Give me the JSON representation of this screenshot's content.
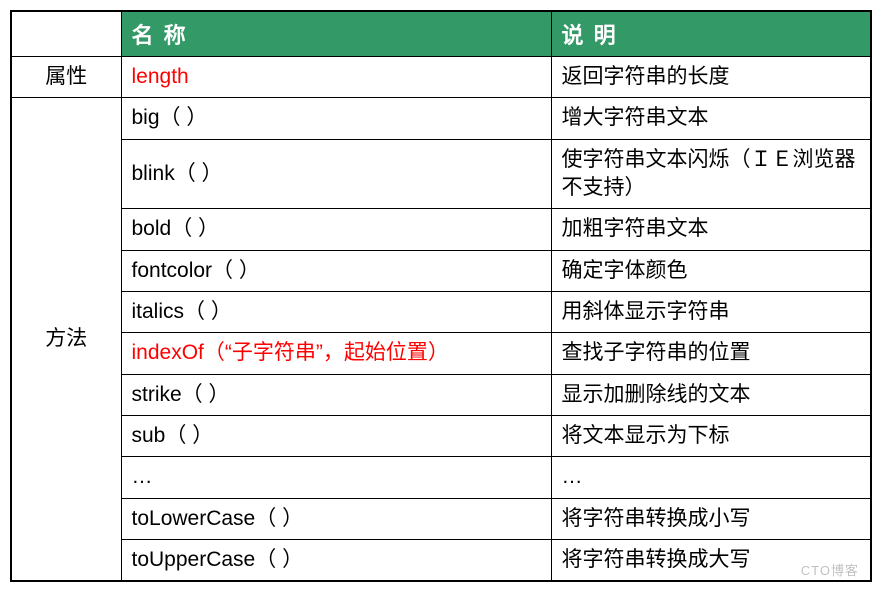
{
  "header": {
    "blank": "",
    "name": "名 称",
    "desc": "说 明"
  },
  "groups": {
    "property": "属性",
    "method": "方法"
  },
  "rows": {
    "length_name": "length",
    "length_desc": "返回字符串的长度",
    "big_name": "big（ ）",
    "big_desc": "增大字符串文本",
    "blink_name": "blink（ ）",
    "blink_desc": "使字符串文本闪烁（ＩＥ浏览器不支持）",
    "bold_name": "bold（ ）",
    "bold_desc": "加粗字符串文本",
    "fontcolor_name": "fontcolor（ ）",
    "fontcolor_desc": "确定字体颜色",
    "italics_name": "italics（ ）",
    "italics_desc": "用斜体显示字符串",
    "indexof_name": "indexOf（“子字符串”，起始位置）",
    "indexof_desc": "查找子字符串的位置",
    "strike_name": "strike（ ）",
    "strike_desc": "显示加删除线的文本",
    "sub_name": "sub（ ）",
    "sub_desc": "将文本显示为下标",
    "ellipsis_name": "…",
    "ellipsis_desc": "…",
    "tolower_name": "toLowerCase（ ）",
    "tolower_desc": "将字符串转换成小写",
    "toupper_name": "toUpperCase（ ）",
    "toupper_desc": "将字符串转换成大写"
  },
  "watermark": "CTO博客"
}
